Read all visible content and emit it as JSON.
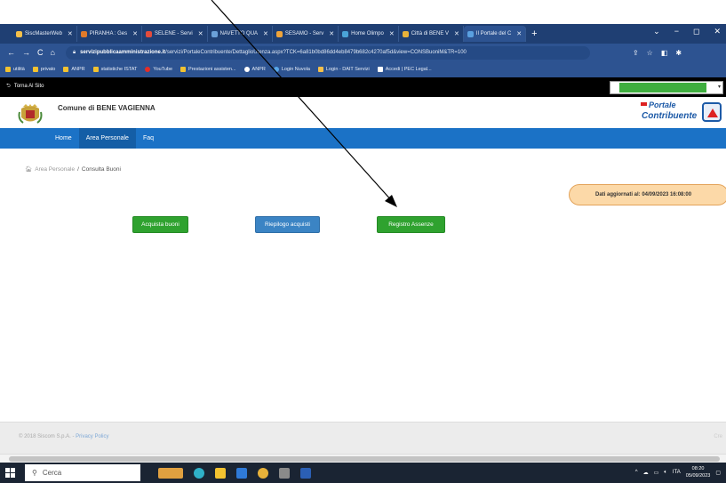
{
  "browser": {
    "tabs": [
      {
        "label": "SiscMasterWeb",
        "color": "#f6c04a"
      },
      {
        "label": "PIRANHA : Ges",
        "color": "#e07a2a"
      },
      {
        "label": "SELENE - Servi",
        "color": "#e34c3c"
      },
      {
        "label": "NAVETTO QUA",
        "color": "#6aa0d8"
      },
      {
        "label": "SESAMO - Serv",
        "color": "#f0a43a"
      },
      {
        "label": "Home Olimpo",
        "color": "#4aa3d8"
      },
      {
        "label": "Città di BENE V",
        "color": "#e8b23a"
      },
      {
        "label": "Il Portale del C",
        "color": "#5aa0e0"
      }
    ],
    "new_tab": "+",
    "window_controls": [
      "⌄",
      "−",
      "◻",
      "✕"
    ],
    "url_host": "servizipubblicaamministrazione.it",
    "url_path": "/servizi/PortaleContribuente/DettaglioUtenza.aspx?TCK=6a81b0bd86dd4eb8479b682c4270af5d&view=CONSBuoniM&TR=100",
    "bookmarks": [
      {
        "label": "utilità",
        "color": "#f2c230"
      },
      {
        "label": "privato",
        "color": "#f2c230"
      },
      {
        "label": "ANPR",
        "color": "#f2c230"
      },
      {
        "label": "statistiche ISTAT",
        "color": "#f2c230"
      },
      {
        "label": "YouTube",
        "color": "#e52d27"
      },
      {
        "label": "Prestazioni assisten...",
        "color": "#f2c230"
      },
      {
        "label": "ANPR",
        "color": "#ffffff"
      },
      {
        "label": "Login Nuvola",
        "color": "#57a6e8"
      },
      {
        "label": "Login - DAIT Servizi",
        "color": "#f6c04a"
      },
      {
        "label": "Accedi | PEC Legal...",
        "color": "#ffffff"
      }
    ]
  },
  "site": {
    "back_label": "Torna Al Sito",
    "comune_title": "Comune di BENE VAGIENNA",
    "portale_line1": "Portale",
    "portale_line2": "Contribuente",
    "nav": [
      "Home",
      "Area Personale",
      "Faq"
    ],
    "breadcrumb_root": "Area Personale",
    "breadcrumb_sep": "/",
    "breadcrumb_current": "Consulta Buoni",
    "updated_label": "Dati aggiornati al: 04/09/2023 16:08:00",
    "buttons": {
      "acquista": "Acquista buoni",
      "riepilogo": "Riepilogo acquisti",
      "registro": "Registro Assenze"
    },
    "footer_copy": "© 2018 Siscom S.p.A. -",
    "footer_privacy": "Privacy Policy",
    "footer_right": "Cre"
  },
  "taskbar": {
    "search_placeholder": "Cerca",
    "lang": "ITA",
    "time": "08:20",
    "date": "05/09/2023"
  },
  "colors": {
    "nav_blue": "#1b72c6",
    "button_green": "#2fa22f",
    "button_blue": "#3b84c4",
    "date_badge": "#fcd9a8"
  }
}
